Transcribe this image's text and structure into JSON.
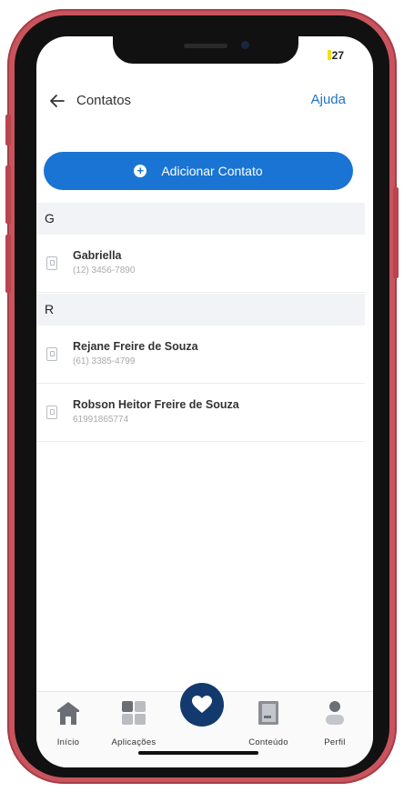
{
  "status": {
    "time": "27"
  },
  "header": {
    "title": "Contatos",
    "help_label": "Ajuda"
  },
  "add_button": {
    "label": "Adicionar Contato"
  },
  "sections": [
    {
      "letter": "G",
      "contacts": [
        {
          "name": "Gabriella",
          "phone": "(12) 3456-7890"
        }
      ]
    },
    {
      "letter": "R",
      "contacts": [
        {
          "name": "Rejane Freire de Souza",
          "phone": "(61) 3385-4799"
        },
        {
          "name": "Robson Heitor Freire de Souza",
          "phone": "61991865774"
        }
      ]
    }
  ],
  "nav": {
    "items": [
      {
        "label": "Início",
        "icon": "home-icon"
      },
      {
        "label": "Aplicações",
        "icon": "apps-icon"
      },
      {
        "label": "Conteúdo",
        "icon": "book-icon"
      },
      {
        "label": "Perfil",
        "icon": "person-icon"
      }
    ],
    "center_icon": "heart-icon"
  },
  "colors": {
    "accent": "#1a74d4",
    "fab": "#123a6e",
    "frame": "#c9545d"
  }
}
